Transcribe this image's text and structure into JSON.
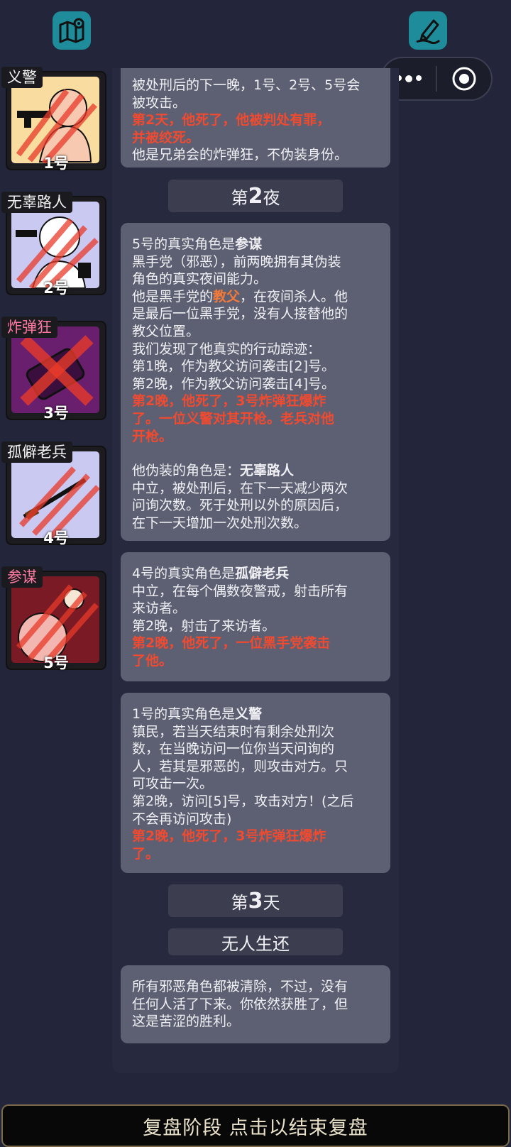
{
  "cards": {
    "c0": {
      "line1": "被处刑后的下一晚，1号、2号、5号会",
      "line2": "被攻击。",
      "red1": "第2天，他死了，他被判处有罪，",
      "red2": "并被绞死。",
      "line3": "他是兄弟会的炸弹狂，不伪装身份。"
    },
    "c1": {
      "l1_pre": "5号的真实角色是",
      "l1_bold": "参谋",
      "l2": "黑手党（邪恶），前两晚拥有其伪装",
      "l3": "角色的真实夜间能力。",
      "l4_pre": "他是黑手党的",
      "l4_red": "教父",
      "l4_post": "，在夜间杀人。他",
      "l5": "是最后一位黑手党，没有人接替他的",
      "l6": "教父位置。",
      "l7": "我们发现了他真实的行动踪迹：",
      "l8": "第1晚，作为教父访问袭击[2]号。",
      "l9": "第2晚，作为教父访问袭击[4]号。",
      "r1": "第2晚，他死了，3号炸弹狂爆炸",
      "r2": "了。一位义警对其开枪。老兵对他",
      "r3": "开枪。",
      "l10_pre": "他伪装的角色是：",
      "l10_bold": "无辜路人",
      "l11": "中立，被处刑后，在下一天减少两次",
      "l12": "问询次数。死于处刑以外的原因后，",
      "l13": "在下一天增加一次处刑次数。"
    },
    "c2": {
      "l1_pre": "4号的真实角色是",
      "l1_bold": "孤僻老兵",
      "l2": "中立，在每个偶数夜警戒，射击所有",
      "l3": "来访者。",
      "l4": "第2晚，射击了来访者。",
      "r1": "第2晚，他死了，一位黑手党袭击",
      "r2": "了他。"
    },
    "c3": {
      "l1_pre": "1号的真实角色是",
      "l1_bold": "义警",
      "l2": "镇民，若当天结束时有剩余处刑次",
      "l3": "数，在当晚访问一位你当天问询的",
      "l4": "人，若其是邪恶的，则攻击对方。只",
      "l5": "可攻击一次。",
      "l6": "第2晚，访问[5]号，攻击对方！(之后",
      "l7": "不会再访问攻击)",
      "r1": "第2晚，他死了，3号炸弹狂爆炸",
      "r2": "了。"
    },
    "c4": {
      "l1": "所有邪恶角色都被清除，不过，没有",
      "l2": "任何人活了下来。你依然获胜了，但",
      "l3": "这是苦涩的胜利。"
    }
  },
  "banners": {
    "night2_pre": "第",
    "night2_num": "2",
    "night2_post": "夜",
    "day3_pre": "第",
    "day3_num": "3",
    "day3_post": "天",
    "no_survivors": "无人生还"
  },
  "players": [
    {
      "role": "义警",
      "number": "1号"
    },
    {
      "role": "无辜路人",
      "number": "2号"
    },
    {
      "role": "炸弹狂",
      "number": "3号"
    },
    {
      "role": "孤僻老兵",
      "number": "4号"
    },
    {
      "role": "参谋",
      "number": "5号"
    }
  ],
  "colors": {
    "accent_red": "#f04a30",
    "bomber_label": "#ff7aa0",
    "strategist_label": "#ff7aa0",
    "icon_bg": "#1f8c9b"
  },
  "bottom_bar": "复盘阶段 点击以结束复盘"
}
